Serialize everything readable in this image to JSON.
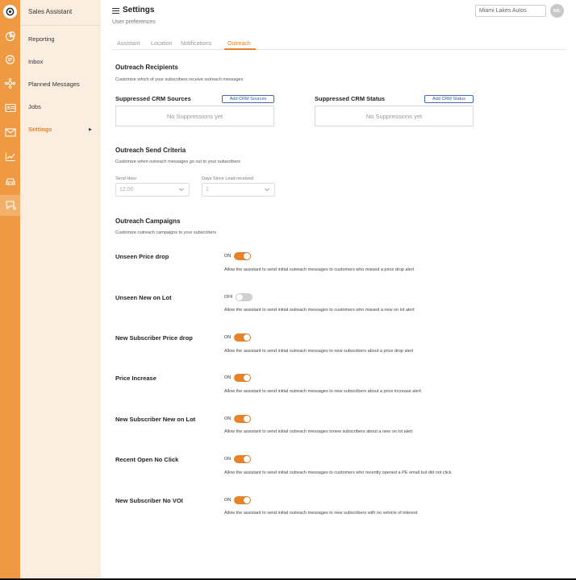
{
  "app": {
    "name": "Sales Assistant"
  },
  "sidebar": {
    "items": [
      {
        "label": "Reporting"
      },
      {
        "label": "Inbox"
      },
      {
        "label": "Planned Messages"
      },
      {
        "label": "Jobs"
      },
      {
        "label": "Settings",
        "active": true
      }
    ]
  },
  "header": {
    "title": "Settings",
    "subtitle": "User preferences",
    "dealer": "Miami Lakes Autos",
    "avatar_initials": "MC"
  },
  "tabs": [
    {
      "label": "Assistant"
    },
    {
      "label": "Location"
    },
    {
      "label": "Notifications"
    },
    {
      "label": "Outreach",
      "active": true
    }
  ],
  "recipients": {
    "title": "Outreach Recipients",
    "desc": "Customize which of your subscribers receive outreach messages",
    "sources": {
      "title": "Suppressed CRM Sources",
      "button": "Add CRM Sources",
      "empty": "No Suppressions yet"
    },
    "status": {
      "title": "Suppressed CRM Status",
      "button": "Add CRM Status",
      "empty": "No Suppressions yet"
    }
  },
  "criteria": {
    "title": "Outreach Send Criteria",
    "desc": "Customize when outreach messages go out to your subscribers",
    "send_hour": {
      "label": "Send Hour",
      "value": "12:00"
    },
    "days_since": {
      "label": "Days Since Lead received",
      "value": "1"
    }
  },
  "campaigns": {
    "title": "Outreach Campaigns",
    "desc": "Customize outreach campaigns to your subscribers",
    "items": [
      {
        "name": "Unseen Price drop",
        "state": "ON",
        "desc": "Allow the assistant to send initial outreach messages to customers who missed a price drop alert"
      },
      {
        "name": "Unseen New on Lot",
        "state": "OFF",
        "desc": "Allow the assistant to send initial outreach messages to customers who missed a new on lot alert"
      },
      {
        "name": "New Subscriber Price drop",
        "state": "ON",
        "desc": "Allow the assistant to send initial outreach messages to new subscribers about a price drop alert"
      },
      {
        "name": "Price Increase",
        "state": "ON",
        "desc": "Allow the assistant to send initial outreach messages to new subscribers about a price increase alert"
      },
      {
        "name": "New Subscriber New on Lot",
        "state": "ON",
        "desc": "Allow the assistant to send initial outreach messages tonew subscribers about a new on lot alert"
      },
      {
        "name": "Recent Open No Click",
        "state": "ON",
        "desc": "Allow the assistant to send initial outreach messages to customers who recently opened a PE email but did not click"
      },
      {
        "name": "New Subscriber No VOI",
        "state": "ON",
        "desc": "Allow the assistant to send initial outreach messages to new subscribers with no vehicle of interest"
      }
    ]
  },
  "colors": {
    "accent": "#e8832a",
    "rail": "#ef9a42",
    "sidebar_bg": "#fbeee0",
    "link": "#2e56a0"
  },
  "icons": [
    "logo-icon",
    "pie-chart-icon",
    "chat-icon",
    "network-icon",
    "contact-card-icon",
    "mail-icon",
    "trend-chart-icon",
    "car-icon",
    "assistant-chat-icon"
  ]
}
